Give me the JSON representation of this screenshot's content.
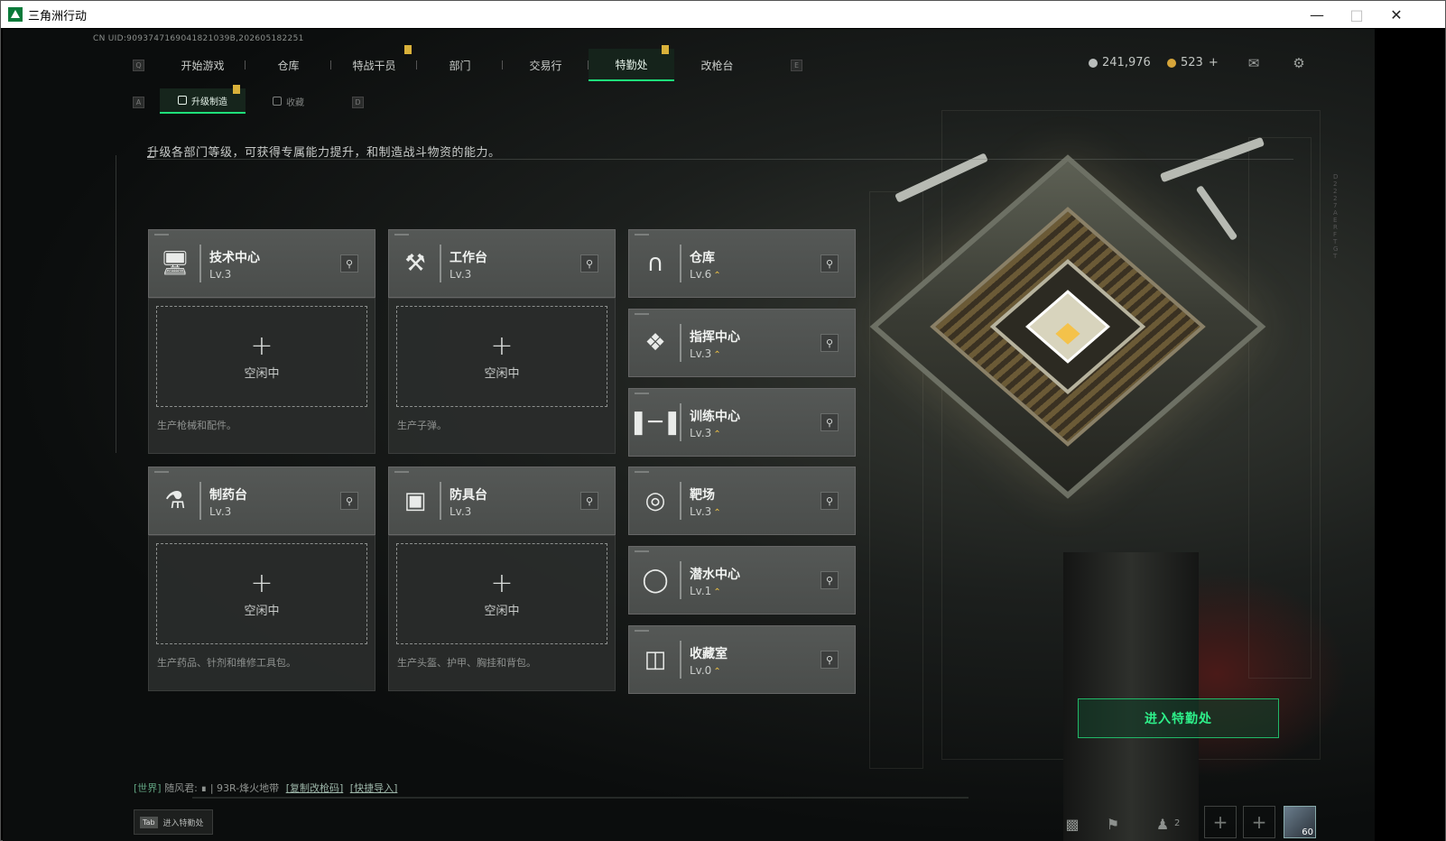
{
  "window": {
    "title": "三角洲行动"
  },
  "header": {
    "uid": "CN UID:9093747169041821039B,202605182251",
    "tabs": [
      {
        "label": "开始游戏",
        "active": false,
        "badge": false
      },
      {
        "label": "仓库",
        "active": false,
        "badge": false
      },
      {
        "label": "特战干员",
        "active": false,
        "badge": true
      },
      {
        "label": "部门",
        "active": false,
        "badge": false
      },
      {
        "label": "交易行",
        "active": false,
        "badge": false
      },
      {
        "label": "特勤处",
        "active": true,
        "badge": true
      },
      {
        "label": "改枪台",
        "active": false,
        "badge": false
      }
    ],
    "key_left": "Q",
    "key_right": "E",
    "currency_silver": "241,976",
    "currency_gold": "523",
    "currency_gold_plus": "+",
    "icons": [
      "mail-icon",
      "settings-icon"
    ]
  },
  "subnav": {
    "key_left": "A",
    "key_right": "D",
    "tabs": [
      {
        "label": "升级制造",
        "active": true,
        "badge": true
      },
      {
        "label": "收藏",
        "active": false,
        "badge": false
      }
    ]
  },
  "description": "升级各部门等级，可获得专属能力提升，和制造战斗物资的能力。",
  "production": [
    {
      "name": "技术中心",
      "level": "Lv.3",
      "icon": "monitor-icon",
      "slot": "空闲中",
      "note": "生产枪械和配件。"
    },
    {
      "name": "工作台",
      "level": "Lv.3",
      "icon": "tools-icon",
      "slot": "空闲中",
      "note": "生产子弹。"
    },
    {
      "name": "制药台",
      "level": "Lv.3",
      "icon": "microscope-icon",
      "slot": "空闲中",
      "note": "生产药品、针剂和维修工具包。"
    },
    {
      "name": "防具台",
      "level": "Lv.3",
      "icon": "armor-icon",
      "slot": "空闲中",
      "note": "生产头盔、护甲、胸挂和背包。"
    }
  ],
  "facilities": [
    {
      "name": "仓库",
      "level": "Lv.6",
      "icon": "warehouse-icon",
      "upgradable": true
    },
    {
      "name": "指挥中心",
      "level": "Lv.3",
      "icon": "command-icon",
      "upgradable": true
    },
    {
      "name": "训练中心",
      "level": "Lv.3",
      "icon": "dumbbell-icon",
      "upgradable": true
    },
    {
      "name": "靶场",
      "level": "Lv.3",
      "icon": "target-icon",
      "upgradable": true
    },
    {
      "name": "潜水中心",
      "level": "Lv.1",
      "icon": "diving-mask-icon",
      "upgradable": true
    },
    {
      "name": "收藏室",
      "level": "Lv.0",
      "icon": "collection-icon",
      "upgradable": true
    }
  ],
  "enter_button": "进入特勤处",
  "chat": {
    "channel": "[世界]",
    "user": "随风君:",
    "message": "| 93R-烽火地带",
    "link1": "[复制改枪码]",
    "link2": "[快捷导入]"
  },
  "tab_hint": {
    "key": "Tab",
    "label": "进入特勤处"
  },
  "bottom": {
    "friends_count": "2",
    "avatar_level": "60"
  },
  "colors": {
    "accent": "#1ee07a",
    "upgrade": "#f0c343",
    "badge": "#d9b13a"
  }
}
